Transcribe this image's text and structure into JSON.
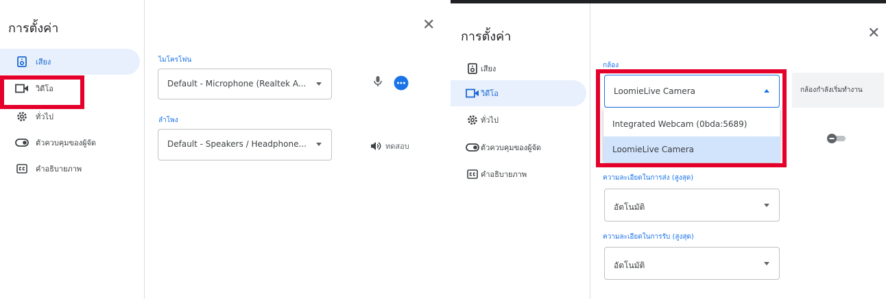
{
  "left": {
    "title": "การตั้งค่า",
    "nav": [
      {
        "label": "เสียง",
        "icon": "speaker-icon",
        "active": true
      },
      {
        "label": "วิดีโอ",
        "icon": "video-camera-icon",
        "active": false
      },
      {
        "label": "ทั่วไป",
        "icon": "gear-icon",
        "active": false
      },
      {
        "label": "ตัวควบคุมของผู้จัด",
        "icon": "toggle-icon",
        "active": false
      },
      {
        "label": "คำอธิบายภาพ",
        "icon": "captions-icon",
        "active": false
      }
    ],
    "microphone": {
      "label": "ไมโครโฟน",
      "value": "Default - Microphone (Realtek A..."
    },
    "speaker": {
      "label": "ลำโพง",
      "value": "Default - Speakers / Headphone...",
      "test_label": "ทดสอบ"
    }
  },
  "right": {
    "title": "การตั้งค่า",
    "nav": [
      {
        "label": "เสียง",
        "icon": "speaker-icon",
        "active": false
      },
      {
        "label": "วิดีโอ",
        "icon": "video-camera-icon",
        "active": true
      },
      {
        "label": "ทั่วไป",
        "icon": "gear-icon",
        "active": false
      },
      {
        "label": "ตัวควบคุมของผู้จัด",
        "icon": "toggle-icon",
        "active": false
      },
      {
        "label": "คำอธิบายภาพ",
        "icon": "captions-icon",
        "active": false
      }
    ],
    "camera": {
      "label": "กล้อง",
      "value": "LoomieLive Camera",
      "options": [
        {
          "label": "Integrated Webcam (0bda:5689)",
          "selected": false
        },
        {
          "label": "LoomieLive Camera",
          "selected": true
        }
      ]
    },
    "preview_status": "กล้องกำลังเริ่มทำงาน",
    "send_resolution": {
      "label": "ความละเอียดในการส่ง (สูงสุด)",
      "value": "อัตโนมัติ"
    },
    "receive_resolution": {
      "label": "ความละเอียดในการรับ (สูงสุด)",
      "value": "อัตโนมัติ"
    }
  },
  "colors": {
    "accent": "#1a73e8",
    "active_bg": "#e8f0fe",
    "highlight": "#e4002b"
  }
}
